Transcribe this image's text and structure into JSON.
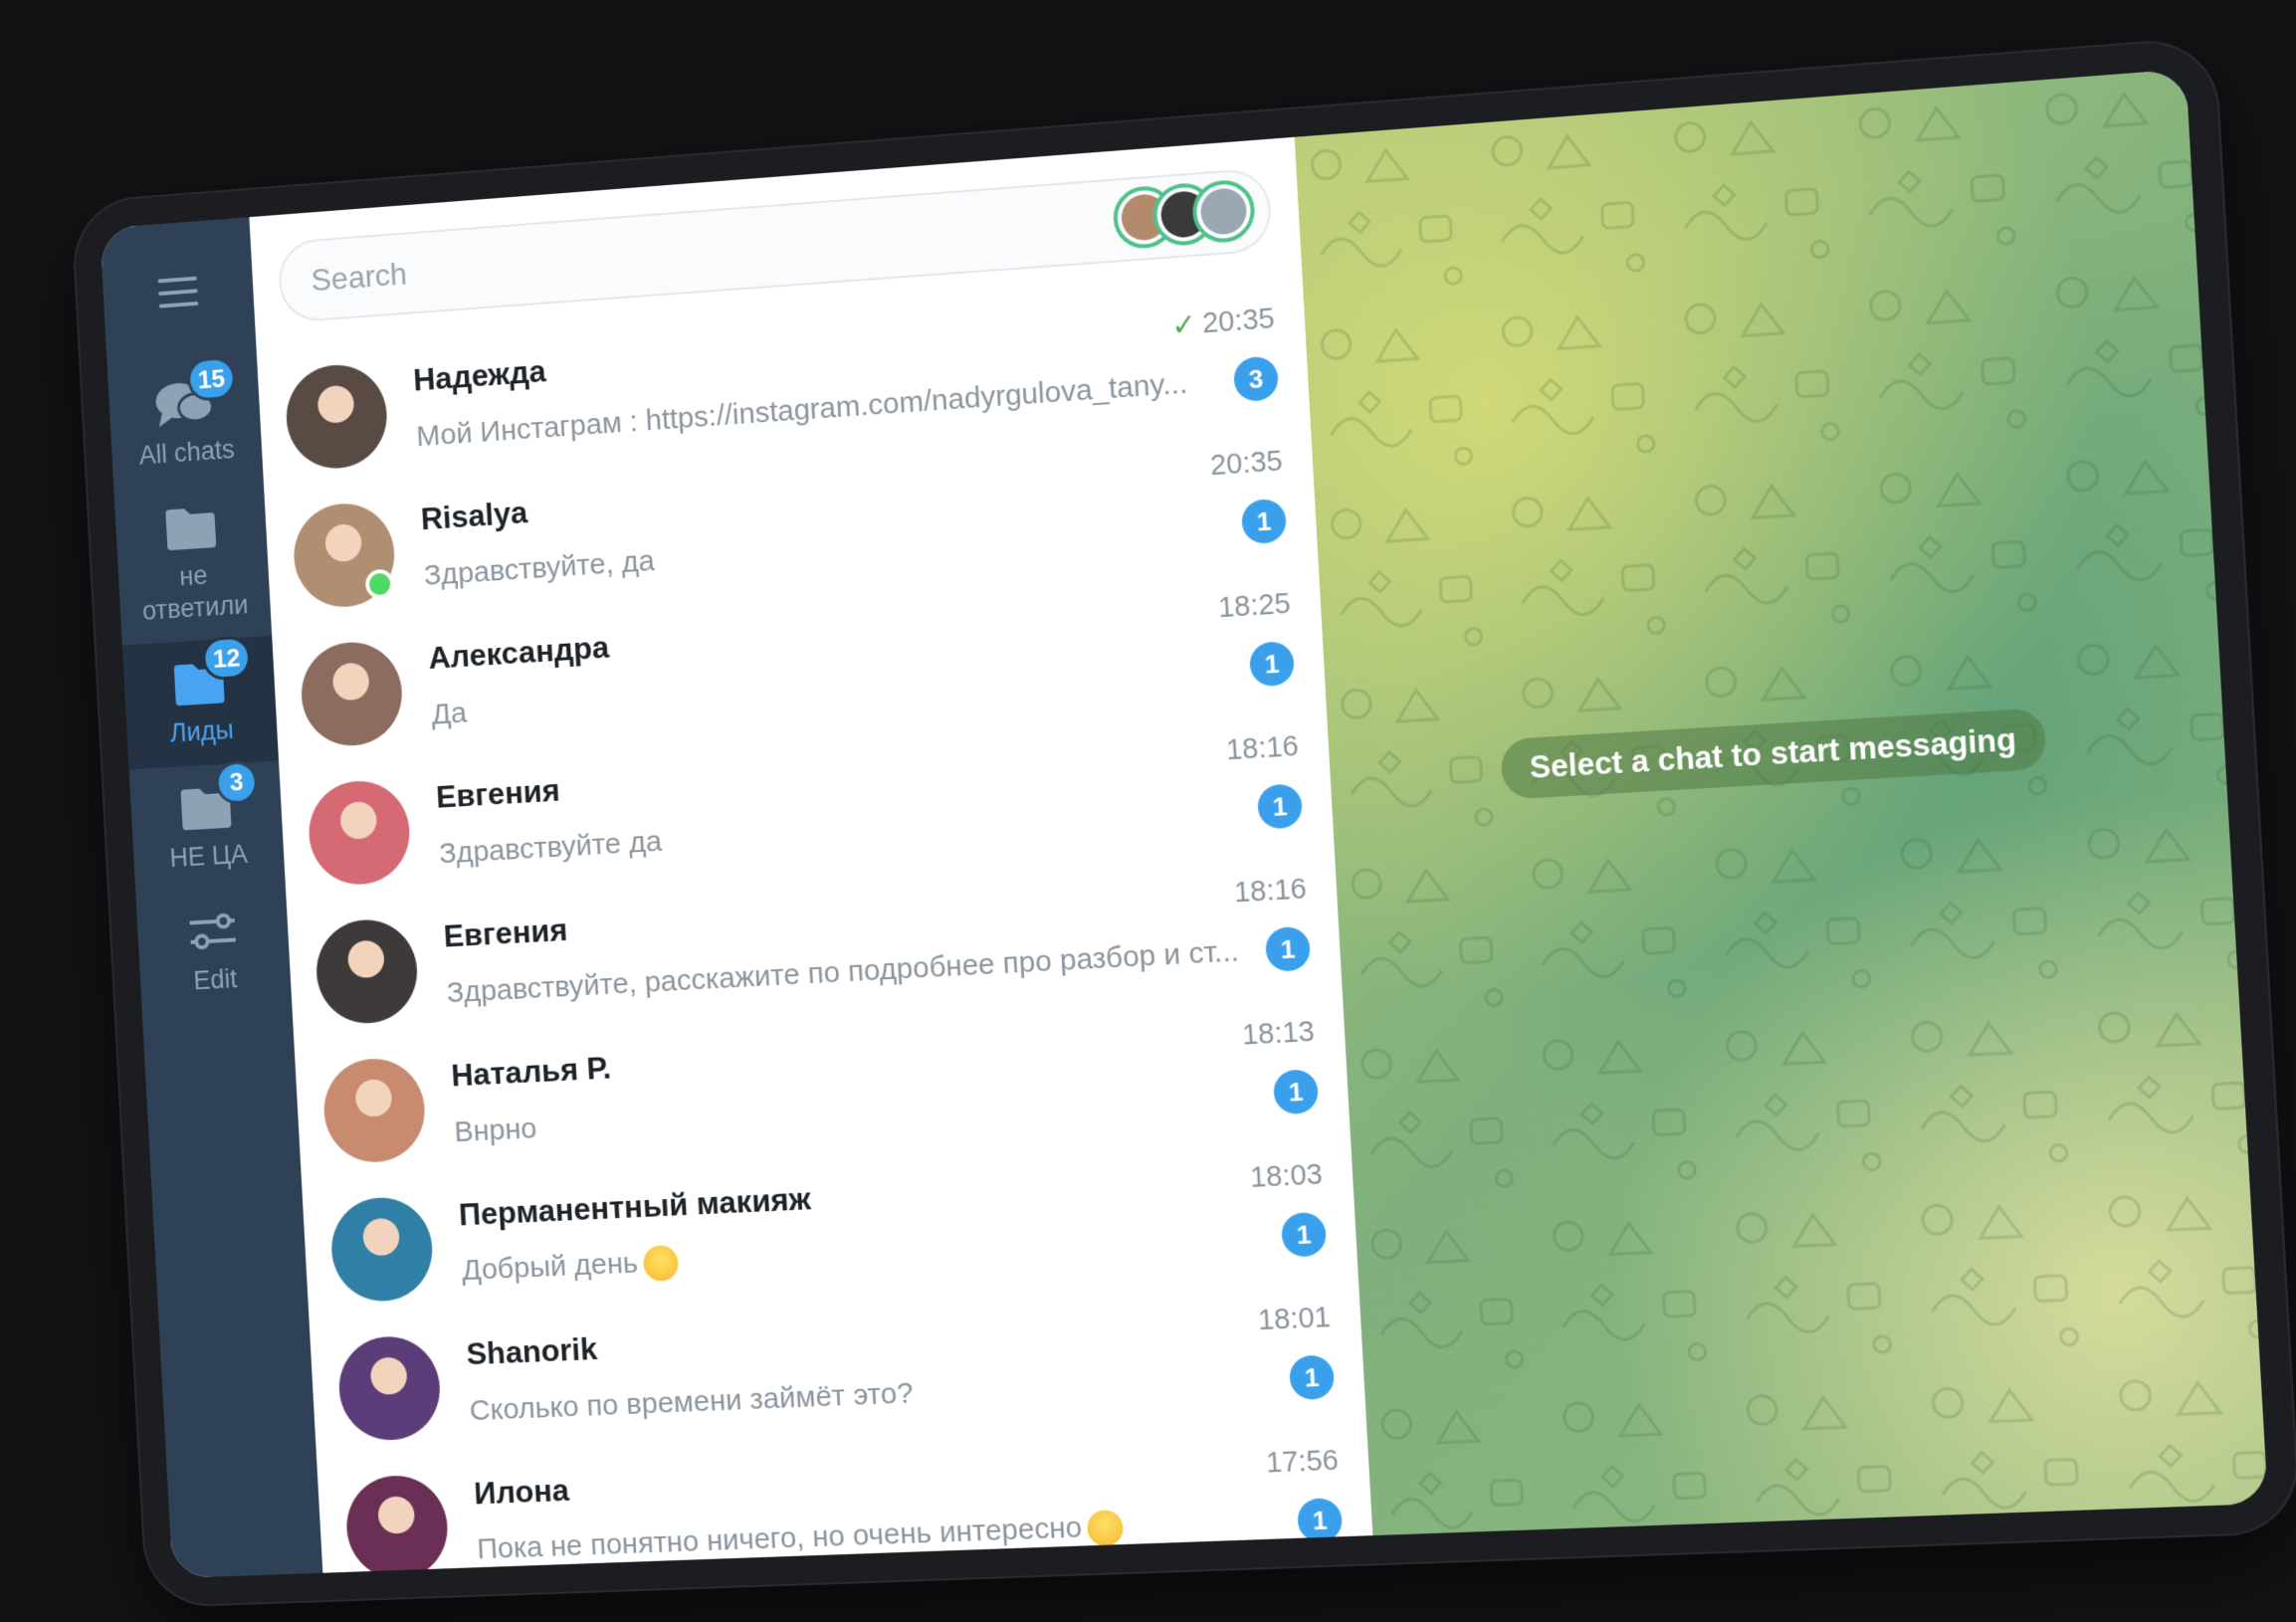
{
  "folders": {
    "items": [
      {
        "label": "All chats",
        "badge": "15"
      },
      {
        "label": "не ответили",
        "badge": ""
      },
      {
        "label": "Лиды",
        "badge": "12"
      },
      {
        "label": "НЕ ЦА",
        "badge": "3"
      },
      {
        "label": "Edit",
        "badge": ""
      }
    ]
  },
  "search": {
    "placeholder": "Search"
  },
  "chats": [
    {
      "name": "Надежда",
      "time": "20:35",
      "preview": "Мой Инстаграм : https://instagram.com/nadyrgulova_tany...",
      "unread": "3",
      "read_check": true,
      "avatar_color": "#5a4a44"
    },
    {
      "name": "Risalya",
      "time": "20:35",
      "preview": "Здравствуйте, да",
      "unread": "1",
      "online": true,
      "avatar_color": "#b08e72"
    },
    {
      "name": "Александра",
      "time": "18:25",
      "preview": "Да",
      "unread": "1",
      "avatar_color": "#8c6c5e"
    },
    {
      "name": "Евгения",
      "time": "18:16",
      "preview": "Здравствуйте да",
      "unread": "1",
      "avatar_color": "#d66a74"
    },
    {
      "name": "Евгения",
      "time": "18:16",
      "preview": "Здравствуйте, расскажите по подробнее про разбор и ст...",
      "unread": "1",
      "avatar_color": "#3e3a3a"
    },
    {
      "name": "Наталья Р.",
      "time": "18:13",
      "preview": "Внрно",
      "unread": "1",
      "avatar_color": "#c98b6f"
    },
    {
      "name": "Перманентный макияж",
      "time": "18:03",
      "preview": "Добрый день",
      "unread": "1",
      "emoji": true,
      "avatar_color": "#2f7fa6"
    },
    {
      "name": "Shanorik",
      "time": "18:01",
      "preview": "Сколько по времени займёт это?",
      "unread": "1",
      "avatar_color": "#5b3d7a"
    },
    {
      "name": "Илона",
      "time": "17:56",
      "preview": "Пока не понятно ничего, но очень интересно",
      "unread": "1",
      "emoji": true,
      "avatar_color": "#6b2f55"
    }
  ],
  "chat_pane": {
    "hint": "Select a chat to start messaging"
  },
  "colors": {
    "accent": "#3ba0ec",
    "sidebar": "#2f4156",
    "sidebar_active": "#243344",
    "online": "#4cd964"
  }
}
